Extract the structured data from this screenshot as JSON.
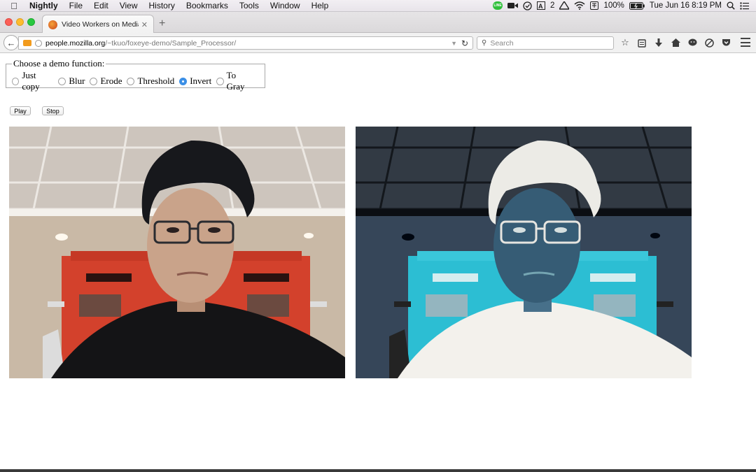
{
  "menubar": {
    "app_name": "Nightly",
    "menus": [
      "File",
      "Edit",
      "View",
      "History",
      "Bookmarks",
      "Tools",
      "Window",
      "Help"
    ],
    "status": {
      "line_icon": "LINE",
      "adobe_count": "2",
      "battery": "100%",
      "datetime": "Tue Jun 16  8:19 PM"
    }
  },
  "browser": {
    "tab_title": "Video Workers on MediaStr...",
    "url_host": "people.mozilla.org",
    "url_path": "/~tkuo/foxeye-demo/Sample_Processor/",
    "search_placeholder": "Search"
  },
  "page": {
    "legend": "Choose a demo function:",
    "options": [
      {
        "label": "Just copy",
        "checked": false
      },
      {
        "label": "Blur",
        "checked": false
      },
      {
        "label": "Erode",
        "checked": false
      },
      {
        "label": "Threshold",
        "checked": false
      },
      {
        "label": "Invert",
        "checked": true
      },
      {
        "label": "To Gray",
        "checked": false
      }
    ],
    "play_label": "Play",
    "stop_label": "Stop"
  },
  "colors": {
    "accent": "#3b8fe6",
    "original_bg": "#cfc6bc",
    "original_hair": "#16171b",
    "original_shirt": "#121214",
    "original_skin": "#c8a48c",
    "original_wall": "#d7402b",
    "inverted_bg": "#30394a",
    "inverted_hair": "#eeeeea",
    "inverted_shirt": "#f2f0eb",
    "inverted_skin": "#375b73",
    "inverted_wall": "#3ed2e6"
  }
}
